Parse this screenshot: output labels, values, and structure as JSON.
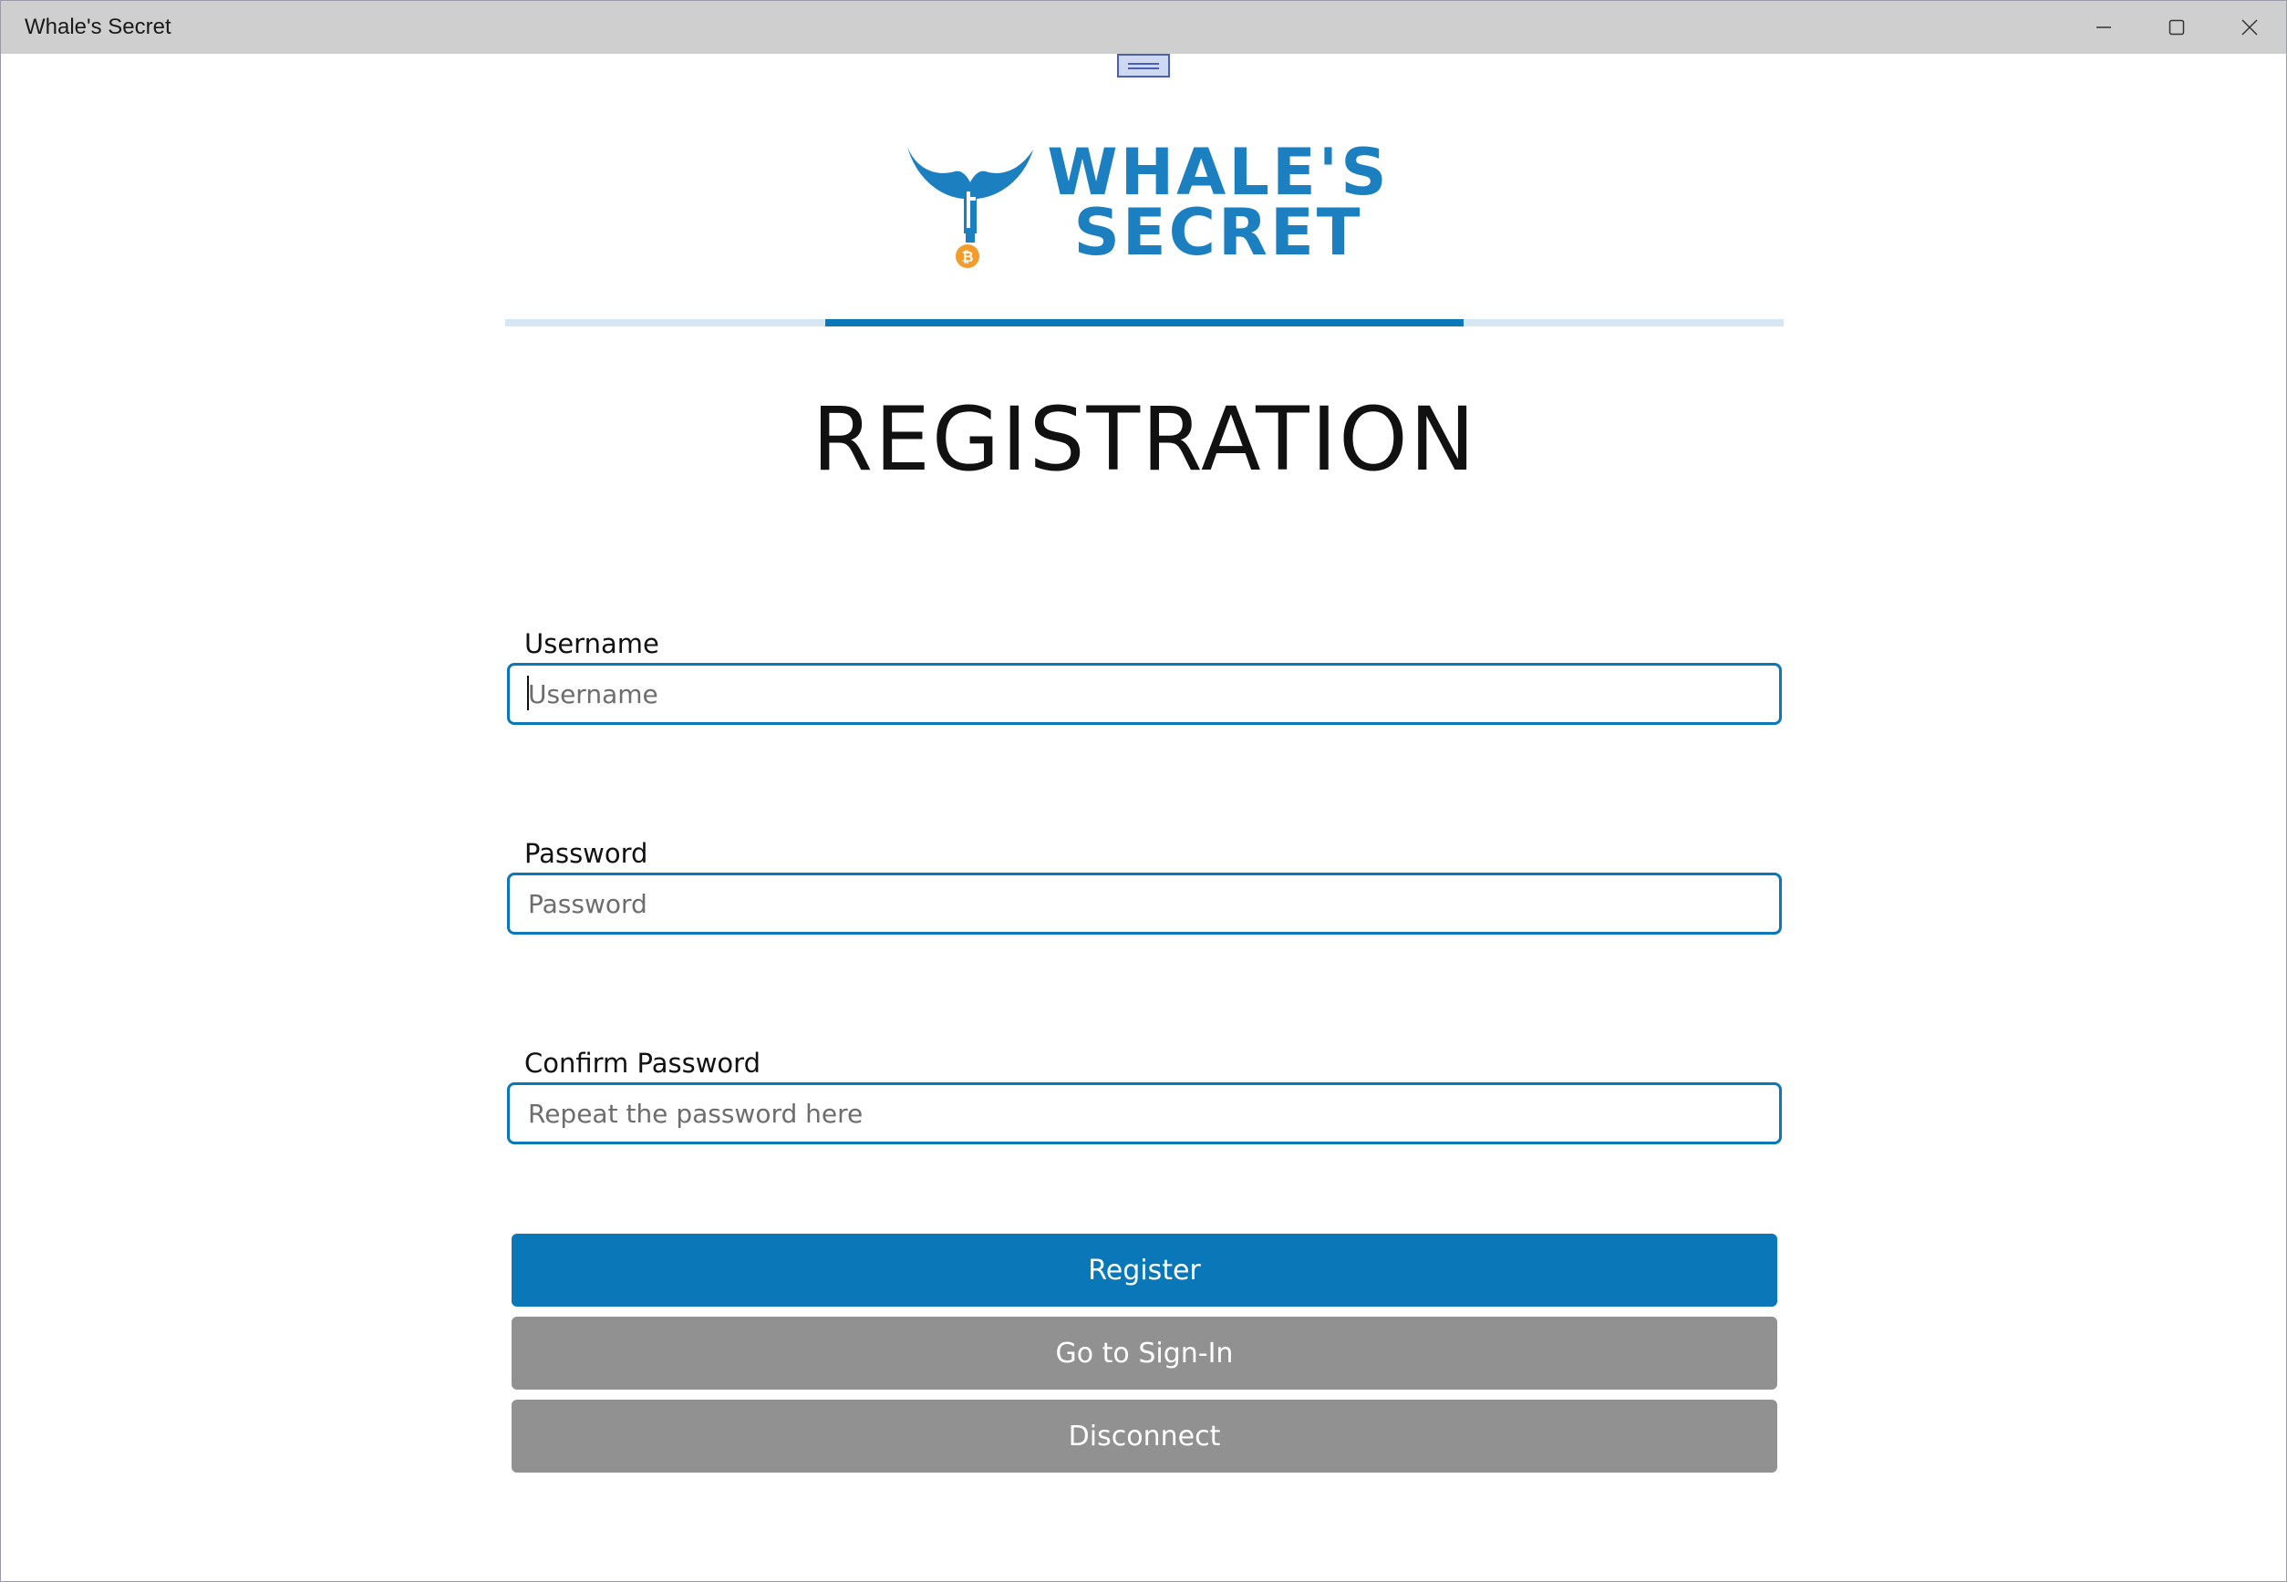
{
  "window": {
    "title": "Whale's Secret"
  },
  "logo": {
    "text_line1": "WHALE'S",
    "text_line2": "SECRET",
    "colors": {
      "primary": "#1b7fc0",
      "coin": "#f39c2a"
    }
  },
  "progress": {
    "step_current": 2,
    "step_total": 3
  },
  "page": {
    "title": "REGISTRATION"
  },
  "form": {
    "username": {
      "label": "Username",
      "placeholder": "Username",
      "value": ""
    },
    "password": {
      "label": "Password",
      "placeholder": "Password",
      "value": ""
    },
    "confirm": {
      "label": "Confirm Password",
      "placeholder": "Repeat the password here",
      "value": ""
    }
  },
  "buttons": {
    "register": "Register",
    "signin": "Go to Sign-In",
    "disconnect": "Disconnect"
  },
  "colors": {
    "accent": "#0a78b8",
    "secondary_button": "#919191",
    "titlebar": "#cfcfcf"
  }
}
